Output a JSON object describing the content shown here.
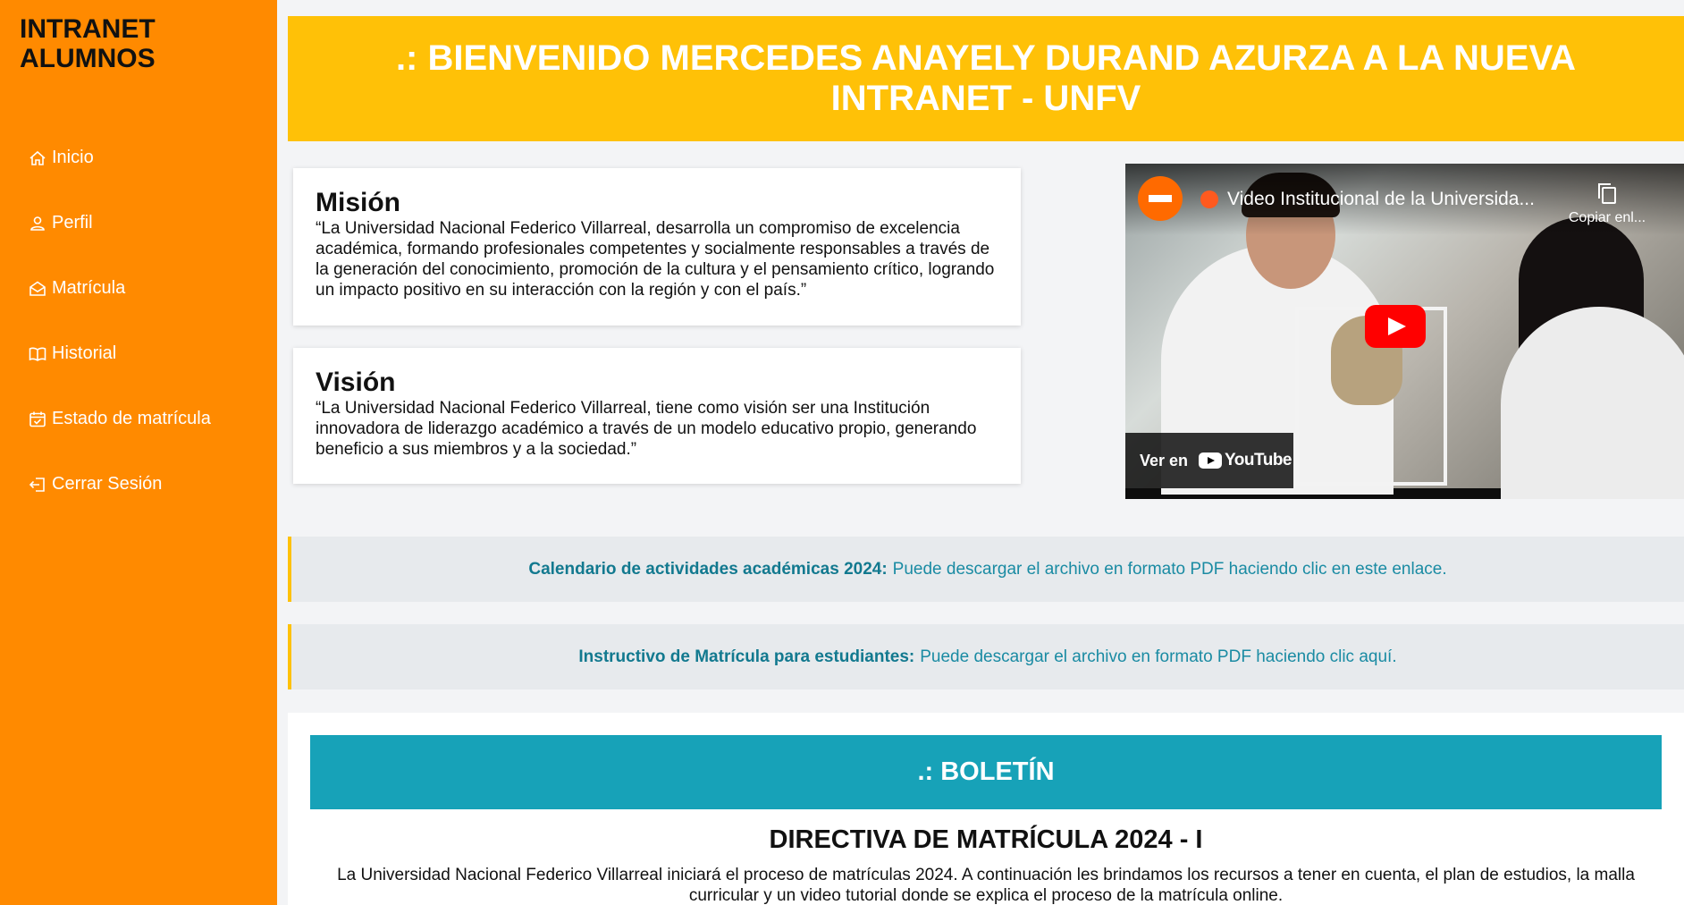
{
  "sidebar": {
    "brand": "INTRANET\nALUMNOS",
    "items": [
      {
        "label": "Inicio",
        "icon": "home-icon"
      },
      {
        "label": "Perfil",
        "icon": "user-icon"
      },
      {
        "label": "Matrícula",
        "icon": "envelope-icon"
      },
      {
        "label": "Historial",
        "icon": "book-icon"
      },
      {
        "label": "Estado de matrícula",
        "icon": "calendar-check-icon"
      },
      {
        "label": "Cerrar Sesión",
        "icon": "logout-icon"
      }
    ]
  },
  "banner": {
    "text": ".: BIENVENIDO MERCEDES ANAYELY DURAND AZURZA A LA NUEVA INTRANET - UNFV"
  },
  "mision": {
    "title": "Misión",
    "text": "“La Universidad Nacional Federico Villarreal, desarrolla un compromiso de excelencia académica, formando profesionales competentes y socialmente responsables a través de la generación del conocimiento, promoción de la cultura y el pensamiento crítico, logrando un impacto positivo en su interacción con la región y con el país.”"
  },
  "vision": {
    "title": "Visión",
    "text": "“La Universidad Nacional Federico Villarreal, tiene como visión ser una Institución innovadora de liderazgo académico a través de un modelo educativo propio, generando beneficio a sus miembros y a la sociedad.”"
  },
  "video": {
    "title": "Video Institucional de la Universida...",
    "copy_label": "Copiar enl...",
    "watch_on": "Ver en",
    "platform": "YouTube"
  },
  "notices": [
    {
      "bold": "Calendario de actividades académicas 2024:",
      "link": "Puede descargar el archivo en formato PDF haciendo clic en este enlace."
    },
    {
      "bold": "Instructivo de Matrícula para estudiantes:",
      "link": "Puede descargar el archivo en formato PDF haciendo clic aquí."
    }
  ],
  "bulletin": {
    "heading": ".: BOLETÍN",
    "title": "DIRECTIVA DE MATRÍCULA 2024 - I",
    "text": "La Universidad Nacional Federico Villarreal iniciará el proceso de matrículas 2024. A continuación les brindamos los recursos a tener en cuenta, el plan de estudios, la malla curricular y un video tutorial donde se explica el proceso de la matrícula online."
  },
  "colors": {
    "sidebar": "#ff8a00",
    "banner": "#ffc107",
    "bulletin_header": "#17a2b8",
    "link": "#1a8ba3"
  }
}
